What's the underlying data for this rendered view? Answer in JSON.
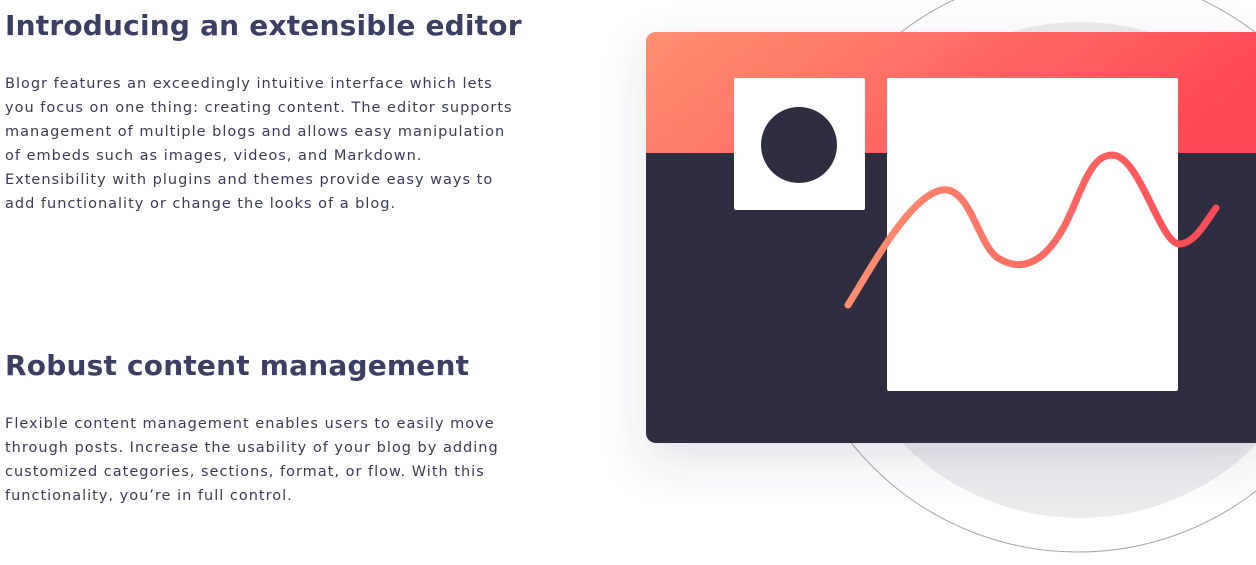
{
  "features": [
    {
      "title": "Introducing an extensible editor",
      "body": "Blogr features an exceedingly intuitive interface which lets you focus on one thing: creating content. The editor supports management of multiple blogs and allows easy manipulation of embeds such as images, videos, and Markdown. Extensibility with plugins and themes provide easy ways to add functionality or change the looks of a blog."
    },
    {
      "title": "Robust content management",
      "body": "Flexible content management enables users to easily move through posts. Increase the usability of your blog by adding customized categories, sections, format, or flow. With this functionality, you’re in full control."
    }
  ],
  "colors": {
    "heading": "#3d3e63",
    "body_text": "#3a3b58",
    "editor_dark": "#2e2e40",
    "gradient_start": "#ff8f71",
    "gradient_end": "#ff4a58",
    "backdrop_circle": "#ebebee"
  }
}
